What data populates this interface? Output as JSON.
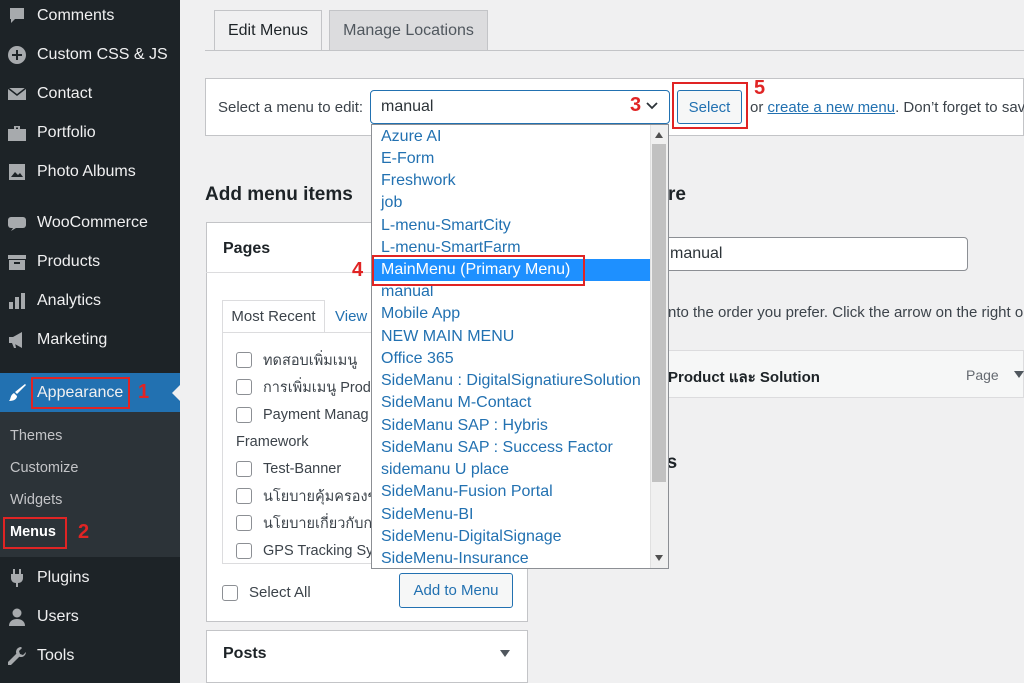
{
  "sidebar": {
    "items": [
      {
        "label": "Comments",
        "icon": "comment-icon"
      },
      {
        "label": "Custom CSS & JS",
        "icon": "plus-circle-icon"
      },
      {
        "label": "Contact",
        "icon": "envelope-icon"
      },
      {
        "label": "Portfolio",
        "icon": "briefcase-icon"
      },
      {
        "label": "Photo Albums",
        "icon": "image-icon"
      },
      {
        "label": "WooCommerce",
        "icon": "woo-icon"
      },
      {
        "label": "Products",
        "icon": "archive-icon"
      },
      {
        "label": "Analytics",
        "icon": "bar-chart-icon"
      },
      {
        "label": "Marketing",
        "icon": "megaphone-icon"
      },
      {
        "label": "Appearance",
        "icon": "brush-icon"
      },
      {
        "label": "Plugins",
        "icon": "plug-icon"
      },
      {
        "label": "Users",
        "icon": "user-icon"
      },
      {
        "label": "Tools",
        "icon": "wrench-icon"
      }
    ],
    "submenu": [
      "Themes",
      "Customize",
      "Widgets",
      "Menus"
    ]
  },
  "tabs": {
    "edit": "Edit Menus",
    "manage": "Manage Locations"
  },
  "manage": {
    "label": "Select a menu to edit:",
    "selected": "manual",
    "select_button": "Select",
    "or_text": "or",
    "create_link": "create a new menu",
    "after_text": ". Don’t forget to sav"
  },
  "dropdown": {
    "options": [
      "Azure AI",
      "E-Form",
      "Freshwork",
      "job",
      "L-menu-SmartCity",
      "L-menu-SmartFarm",
      "MainMenu (Primary Menu)",
      "manual",
      "Mobile App",
      "NEW MAIN MENU",
      "Office 365",
      "SideManu : DigitalSignatiureSolution",
      "SideManu M-Contact",
      "SideManu SAP : Hybris",
      "SideManu SAP : Success Factor",
      "sidemanu U place",
      "SideManu-Fusion Portal",
      "SideMenu-BI",
      "SideMenu-DigitalSignage",
      "SideMenu-Insurance"
    ],
    "highlighted_index": 6
  },
  "left": {
    "heading": "Add menu items",
    "pages_title": "Pages",
    "tab_recent": "Most Recent",
    "tab_view": "View",
    "items": [
      "ทดสอบเพิ่มเมนู",
      "การเพิ่มเมนู Prod",
      "Payment Manag"
    ],
    "group": "Framework",
    "items2": [
      "Test-Banner",
      "นโยบายคุ้มครองข",
      "นโยบายเกี่ยวกับก",
      "GPS Tracking Sys"
    ],
    "select_all": "Select All",
    "add_button": "Add to Menu",
    "posts_title": "Posts"
  },
  "right": {
    "heading_fragment": "re",
    "menu_name": "manual",
    "hint": "nto the order you prefer. Click the arrow on the right o",
    "item_title": "Product และ Solution",
    "item_type": "Page",
    "settings_fragment": "gs"
  },
  "annotations": [
    "1",
    "2",
    "3",
    "4",
    "5"
  ],
  "colors": {
    "accent": "#2271b1",
    "sidebar": "#1d2327",
    "annotation": "#e02424",
    "highlight": "#1e90ff"
  }
}
